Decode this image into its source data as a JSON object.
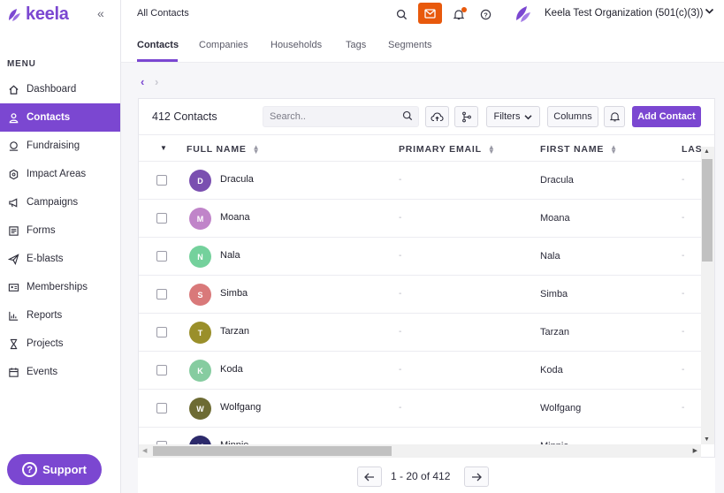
{
  "brand": {
    "name": "keela",
    "accent": "#7b47d1"
  },
  "sidebar": {
    "menu_heading": "MENU",
    "items": [
      {
        "label": "Dashboard",
        "icon": "home-icon",
        "active": false
      },
      {
        "label": "Contacts",
        "icon": "user-icon",
        "active": true
      },
      {
        "label": "Fundraising",
        "icon": "fundraising-icon",
        "active": false
      },
      {
        "label": "Impact Areas",
        "icon": "impact-icon",
        "active": false
      },
      {
        "label": "Campaigns",
        "icon": "megaphone-icon",
        "active": false
      },
      {
        "label": "Forms",
        "icon": "form-icon",
        "active": false
      },
      {
        "label": "E-blasts",
        "icon": "send-icon",
        "active": false
      },
      {
        "label": "Memberships",
        "icon": "id-card-icon",
        "active": false
      },
      {
        "label": "Reports",
        "icon": "chart-icon",
        "active": false
      },
      {
        "label": "Projects",
        "icon": "hourglass-icon",
        "active": false
      },
      {
        "label": "Events",
        "icon": "calendar-icon",
        "active": false
      }
    ],
    "support_label": "Support"
  },
  "topbar": {
    "title": "All Contacts",
    "org_name": "Keela Test Organization (501(c)(3))",
    "mail_color": "#e8590c"
  },
  "tabs": [
    {
      "label": "Contacts",
      "active": true
    },
    {
      "label": "Companies",
      "active": false
    },
    {
      "label": "Households",
      "active": false
    },
    {
      "label": "Tags",
      "active": false
    },
    {
      "label": "Segments",
      "active": false
    }
  ],
  "panel": {
    "count_label": "412 Contacts",
    "search_placeholder": "Search..",
    "filters_label": "Filters",
    "columns_label": "Columns",
    "add_label": "Add Contact"
  },
  "table": {
    "columns": [
      "FULL NAME",
      "PRIMARY EMAIL",
      "FIRST NAME",
      "LAS"
    ],
    "rows": [
      {
        "initial": "D",
        "full_name": "Dracula",
        "email": "-",
        "first_name": "Dracula",
        "last_name": "-",
        "color": "#7a4fb0"
      },
      {
        "initial": "M",
        "full_name": "Moana",
        "email": "-",
        "first_name": "Moana",
        "last_name": "-",
        "color": "#c084c9"
      },
      {
        "initial": "N",
        "full_name": "Nala",
        "email": "-",
        "first_name": "Nala",
        "last_name": "-",
        "color": "#74d19c"
      },
      {
        "initial": "S",
        "full_name": "Simba",
        "email": "-",
        "first_name": "Simba",
        "last_name": "-",
        "color": "#d9797a"
      },
      {
        "initial": "T",
        "full_name": "Tarzan",
        "email": "-",
        "first_name": "Tarzan",
        "last_name": "-",
        "color": "#9a8f2a"
      },
      {
        "initial": "K",
        "full_name": "Koda",
        "email": "-",
        "first_name": "Koda",
        "last_name": "-",
        "color": "#86cca0"
      },
      {
        "initial": "W",
        "full_name": "Wolfgang",
        "email": "-",
        "first_name": "Wolfgang",
        "last_name": "-",
        "color": "#6d6b33"
      },
      {
        "initial": "M",
        "full_name": "Minnie",
        "email": "-",
        "first_name": "Minnie",
        "last_name": "-",
        "color": "#2c2a6b"
      }
    ]
  },
  "pagination": {
    "range_label": "1 - 20 of 412"
  }
}
